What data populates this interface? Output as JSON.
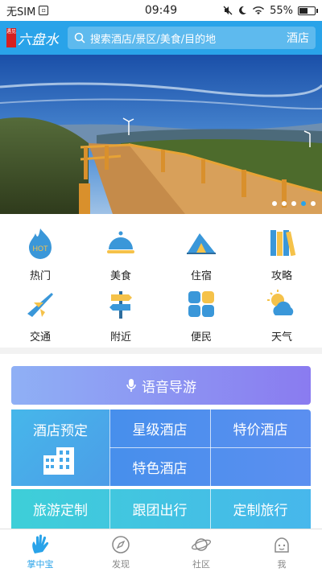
{
  "status_bar": {
    "carrier": "无SIM",
    "time": "09:49",
    "battery": "55%",
    "battery_level": 0.55
  },
  "header": {
    "logo_seal": "遇见",
    "logo_text": "六盘水",
    "search_placeholder": "搜索酒店/景区/美食/目的地",
    "search_scope": "酒店"
  },
  "banner": {
    "slide_count": 5,
    "active_index": 3
  },
  "categories": [
    {
      "label": "热门",
      "icon": "hot-flame-icon",
      "badge": "HOT"
    },
    {
      "label": "美食",
      "icon": "food-cloche-icon"
    },
    {
      "label": "住宿",
      "icon": "tent-icon"
    },
    {
      "label": "攻略",
      "icon": "books-icon"
    },
    {
      "label": "交通",
      "icon": "airplane-icon"
    },
    {
      "label": "附近",
      "icon": "signpost-icon"
    },
    {
      "label": "便民",
      "icon": "grid-tiles-icon"
    },
    {
      "label": "天气",
      "icon": "weather-icon"
    }
  ],
  "voice_guide": {
    "label": "语音导游"
  },
  "services": {
    "hotel_booking": "酒店预定",
    "star_hotel": "星级酒店",
    "special_price_hotel": "特价酒店",
    "featured_hotel": "特色酒店",
    "travel_custom": "旅游定制",
    "group_tour": "跟团出行",
    "custom_trip": "定制旅行"
  },
  "tabs": [
    {
      "label": "掌中宝",
      "icon": "palm-hand-icon",
      "active": true
    },
    {
      "label": "发现",
      "icon": "compass-icon",
      "active": false
    },
    {
      "label": "社区",
      "icon": "planet-icon",
      "active": false
    },
    {
      "label": "我",
      "icon": "face-icon",
      "active": false
    }
  ],
  "colors": {
    "brand": "#29a3e9",
    "tab_active": "#29a3e9",
    "voice_gradient_start": "#8fb0f5",
    "voice_gradient_end": "#8a7bf0"
  }
}
